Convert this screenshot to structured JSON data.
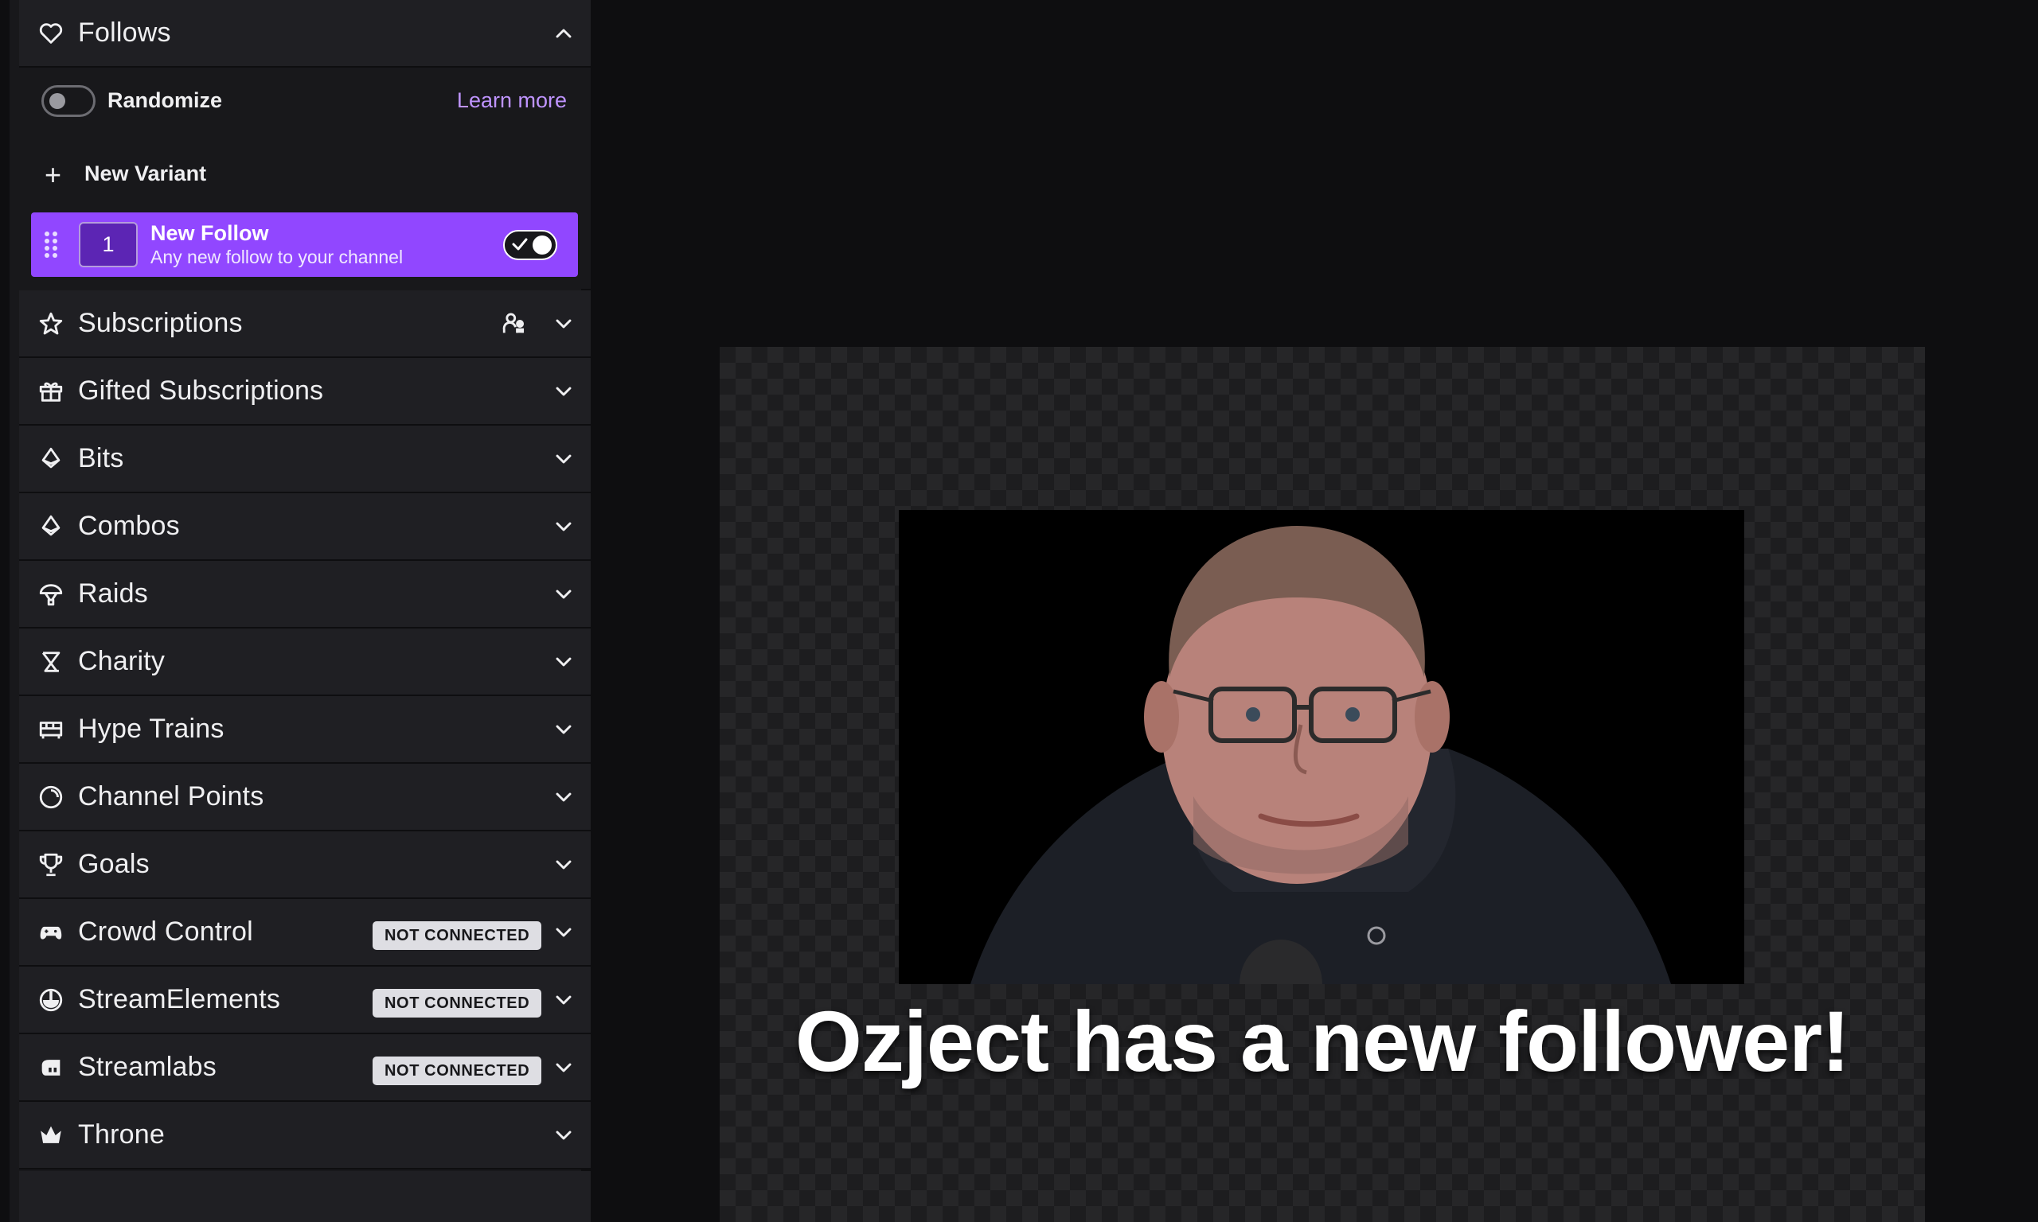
{
  "sidebar": {
    "follows": {
      "title": "Follows",
      "randomize_label": "Randomize",
      "learn_more": "Learn more",
      "new_variant": "New Variant",
      "variant": {
        "number": "1",
        "title": "New Follow",
        "subtitle": "Any new follow to your channel",
        "enabled": true
      }
    },
    "sections": [
      {
        "title": "Subscriptions",
        "icon": "star-icon"
      },
      {
        "title": "Gifted Subscriptions",
        "icon": "gift-icon"
      },
      {
        "title": "Bits",
        "icon": "bits-icon"
      },
      {
        "title": "Combos",
        "icon": "combos-icon"
      },
      {
        "title": "Raids",
        "icon": "raid-icon"
      },
      {
        "title": "Charity",
        "icon": "charity-icon"
      },
      {
        "title": "Hype Trains",
        "icon": "train-icon"
      },
      {
        "title": "Channel Points",
        "icon": "channel-points-icon"
      },
      {
        "title": "Goals",
        "icon": "trophy-icon"
      },
      {
        "title": "Crowd Control",
        "icon": "gamepad-icon",
        "badge": "NOT CONNECTED"
      },
      {
        "title": "StreamElements",
        "icon": "streamelements-icon",
        "badge": "NOT CONNECTED"
      },
      {
        "title": "Streamlabs",
        "icon": "streamlabs-icon",
        "badge": "NOT CONNECTED"
      },
      {
        "title": "Throne",
        "icon": "crown-icon"
      }
    ]
  },
  "preview": {
    "alert_text": "Ozject has a new follower!"
  },
  "colors": {
    "accent": "#9147ff",
    "link": "#bf94ff",
    "panel": "#1f1f23",
    "background": "#0e0e10"
  }
}
